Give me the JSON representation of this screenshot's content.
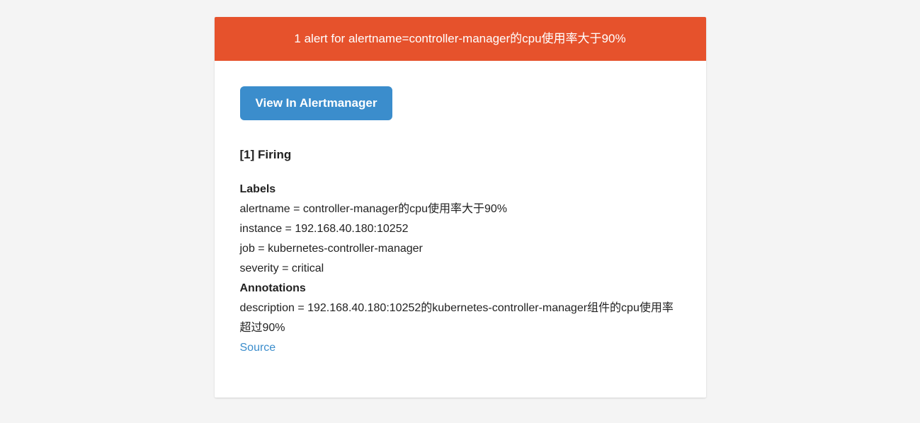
{
  "header": {
    "title": "1 alert for alertname=controller-manager的cpu使用率大于90%"
  },
  "button": {
    "view_label": "View In Alertmanager"
  },
  "firing": {
    "heading": "[1] Firing"
  },
  "labels": {
    "heading": "Labels",
    "items": [
      "alertname = controller-manager的cpu使用率大于90%",
      "instance = 192.168.40.180:10252",
      "job = kubernetes-controller-manager",
      "severity = critical"
    ]
  },
  "annotations": {
    "heading": "Annotations",
    "items": [
      "description = 192.168.40.180:10252的kubernetes-controller-manager组件的cpu使用率超过90%"
    ]
  },
  "source": {
    "label": "Source"
  }
}
